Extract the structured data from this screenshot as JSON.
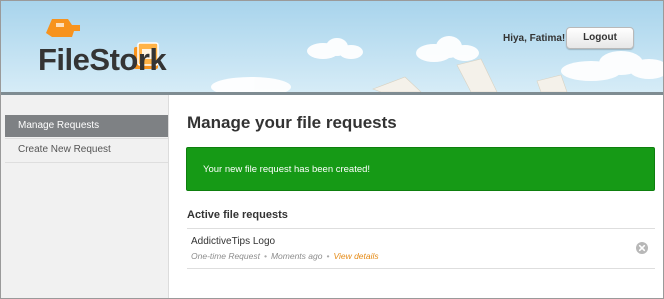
{
  "app": {
    "logo_text": "FileStork"
  },
  "header": {
    "greeting": "Hiya, Fatima!",
    "logout_label": "Logout"
  },
  "sidebar": {
    "items": [
      {
        "label": "Manage Requests",
        "active": true
      },
      {
        "label": "Create New Request",
        "active": false
      }
    ]
  },
  "main": {
    "title": "Manage your file requests",
    "alert": "Your new file request has been created!",
    "section_title": "Active file requests",
    "requests": [
      {
        "name": "AddictiveTips Logo",
        "type": "One-time Request",
        "time": "Moments ago",
        "link": "View details",
        "dot": "•"
      }
    ]
  },
  "colors": {
    "success": "#169a16",
    "link": "#e58b17",
    "logo_orange": "#f7931e",
    "sidebar_active": "#7e8184"
  },
  "icons": [
    "stork-logo-icon",
    "folder-icon",
    "remove-icon"
  ]
}
